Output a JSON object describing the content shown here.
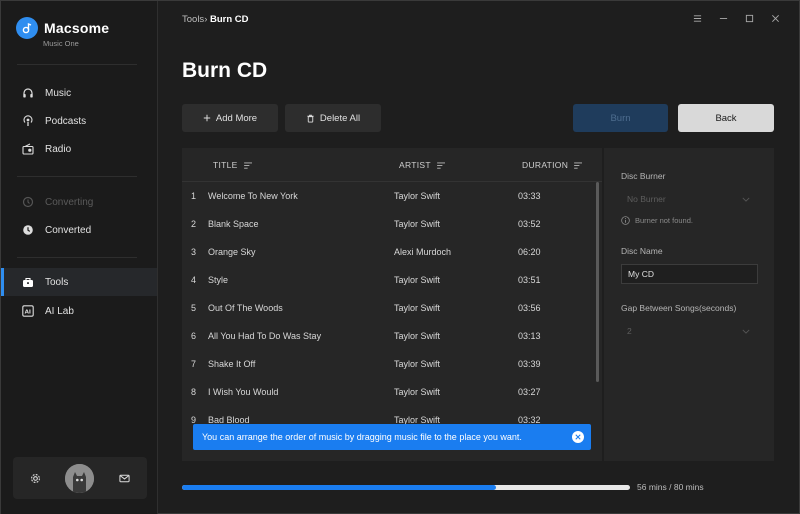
{
  "app": {
    "name": "Macsome",
    "subtitle": "Music One"
  },
  "sidebar": {
    "items": [
      {
        "label": "Music",
        "icon": "headphones-icon"
      },
      {
        "label": "Podcasts",
        "icon": "podcast-icon"
      },
      {
        "label": "Radio",
        "icon": "radio-icon"
      },
      {
        "label": "Converting",
        "icon": "converting-icon",
        "disabled": true
      },
      {
        "label": "Converted",
        "icon": "clock-icon"
      },
      {
        "label": "Tools",
        "icon": "toolbox-icon",
        "active": true
      },
      {
        "label": "AI Lab",
        "icon": "ai-icon"
      }
    ]
  },
  "breadcrumb": {
    "parent": "Tools",
    "separator": "›",
    "current": "Burn CD"
  },
  "page": {
    "title": "Burn CD"
  },
  "toolbar": {
    "add_more": "Add More",
    "delete_all": "Delete All",
    "burn": "Burn",
    "back": "Back"
  },
  "table": {
    "headers": {
      "title": "TITLE",
      "artist": "ARTIST",
      "duration": "DURATION"
    },
    "rows": [
      {
        "num": "1",
        "title": "Welcome To New York",
        "artist": "Taylor Swift",
        "duration": "03:33"
      },
      {
        "num": "2",
        "title": "Blank Space",
        "artist": "Taylor Swift",
        "duration": "03:52"
      },
      {
        "num": "3",
        "title": "Orange Sky",
        "artist": "Alexi Murdoch",
        "duration": "06:20"
      },
      {
        "num": "4",
        "title": "Style",
        "artist": "Taylor Swift",
        "duration": "03:51"
      },
      {
        "num": "5",
        "title": "Out Of The Woods",
        "artist": "Taylor Swift",
        "duration": "03:56"
      },
      {
        "num": "6",
        "title": "All You Had To Do Was Stay",
        "artist": "Taylor Swift",
        "duration": "03:13"
      },
      {
        "num": "7",
        "title": "Shake It Off",
        "artist": "Taylor Swift",
        "duration": "03:39"
      },
      {
        "num": "8",
        "title": "I Wish You Would",
        "artist": "Taylor Swift",
        "duration": "03:27"
      },
      {
        "num": "9",
        "title": "Bad Blood",
        "artist": "Taylor Swift",
        "duration": "03:32"
      }
    ]
  },
  "toast": {
    "message": "You can arrange the order of music by dragging music file to the place you want."
  },
  "settings": {
    "disc_burner_label": "Disc Burner",
    "disc_burner_value": "No Burner",
    "burner_hint": "Burner not found.",
    "disc_name_label": "Disc Name",
    "disc_name_value": "My CD",
    "gap_label": "Gap Between Songs(seconds)",
    "gap_value": "2"
  },
  "progress": {
    "text": "56 mins / 80 mins",
    "used_minutes": 56,
    "total_minutes": 80
  },
  "colors": {
    "accent": "#1a7df0",
    "burn_disabled": "#1f3c5c",
    "back_button": "#d9d9d9"
  }
}
